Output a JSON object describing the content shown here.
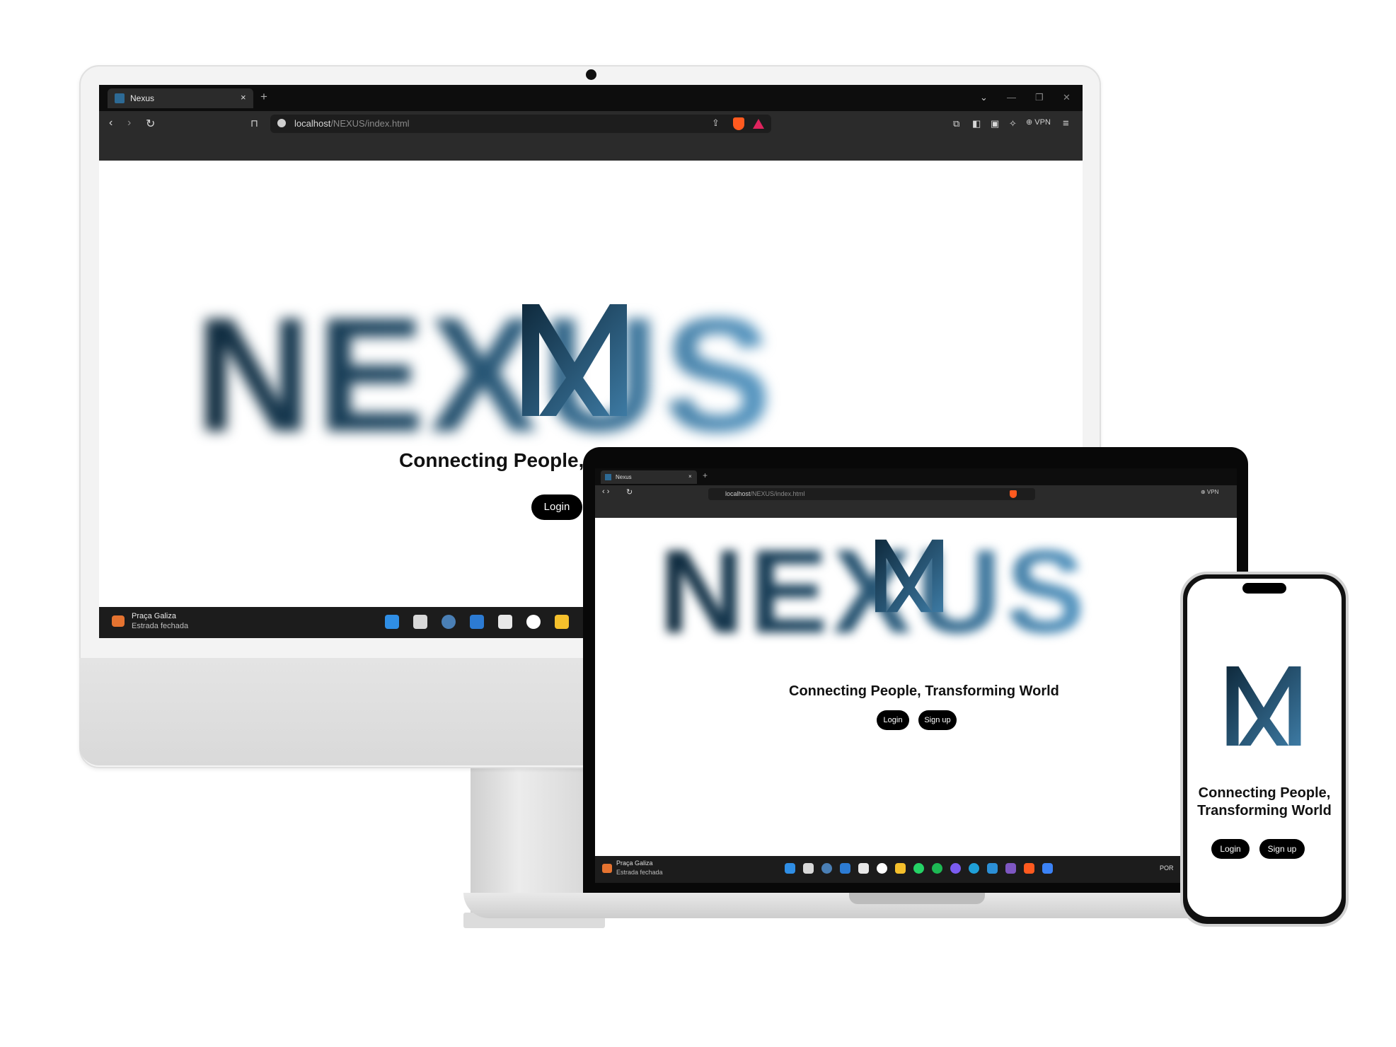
{
  "browser": {
    "tab_title": "Nexus",
    "tab_close": "×",
    "new_tab": "+",
    "url_host": "localhost",
    "url_path": "/NEXUS/index.html",
    "vpn_label": "⊕ VPN"
  },
  "page": {
    "logo_text": "NEXUS",
    "tagline": "Connecting People, Transforming World",
    "tagline_desktop_visible": "Connecting People,",
    "tagline_line1": "Connecting People,",
    "tagline_line2": "Transforming World",
    "login_label": "Login",
    "signup_label": "Sign up"
  },
  "taskbar": {
    "weather_title": "Praça Galiza",
    "weather_status": "Estrada fechada",
    "lang": "POR"
  },
  "colors": {
    "logo_dark": "#0f2a3d",
    "logo_light": "#5a9ac5",
    "browser_bg": "#2b2b2b",
    "tab_strip": "#0d0d0d",
    "taskbar": "#1c1c1c"
  },
  "icons": [
    "back-icon",
    "forward-icon",
    "reload-icon",
    "bookmark-icon",
    "info-icon",
    "share-icon",
    "brave-shield-icon",
    "brave-rewards-icon",
    "extensions-icon",
    "sidebar-icon",
    "wallet-icon",
    "leo-icon",
    "menu-icon",
    "windows-start-icon",
    "weather-icon"
  ]
}
